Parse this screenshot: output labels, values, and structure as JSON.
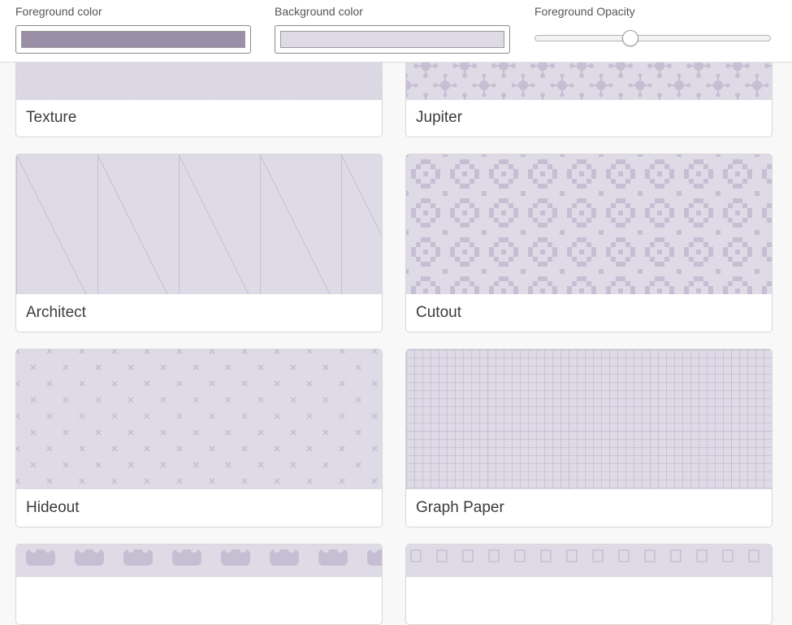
{
  "colors": {
    "foreground": "#9b8fa8",
    "background": "#dedbe6",
    "pattern": "#c6bfd3",
    "pattern_light": "#cdc6d8"
  },
  "toolbar": {
    "foreground_label": "Foreground color",
    "background_label": "Background color",
    "opacity_label": "Foreground Opacity",
    "opacity_value": 0.4
  },
  "patterns": [
    {
      "id": "texture",
      "name": "Texture"
    },
    {
      "id": "jupiter",
      "name": "Jupiter"
    },
    {
      "id": "architect",
      "name": "Architect"
    },
    {
      "id": "cutout",
      "name": "Cutout"
    },
    {
      "id": "hideout",
      "name": "Hideout"
    },
    {
      "id": "graph-paper",
      "name": "Graph Paper"
    },
    {
      "id": "unknown-left",
      "name": ""
    },
    {
      "id": "unknown-right",
      "name": ""
    }
  ]
}
